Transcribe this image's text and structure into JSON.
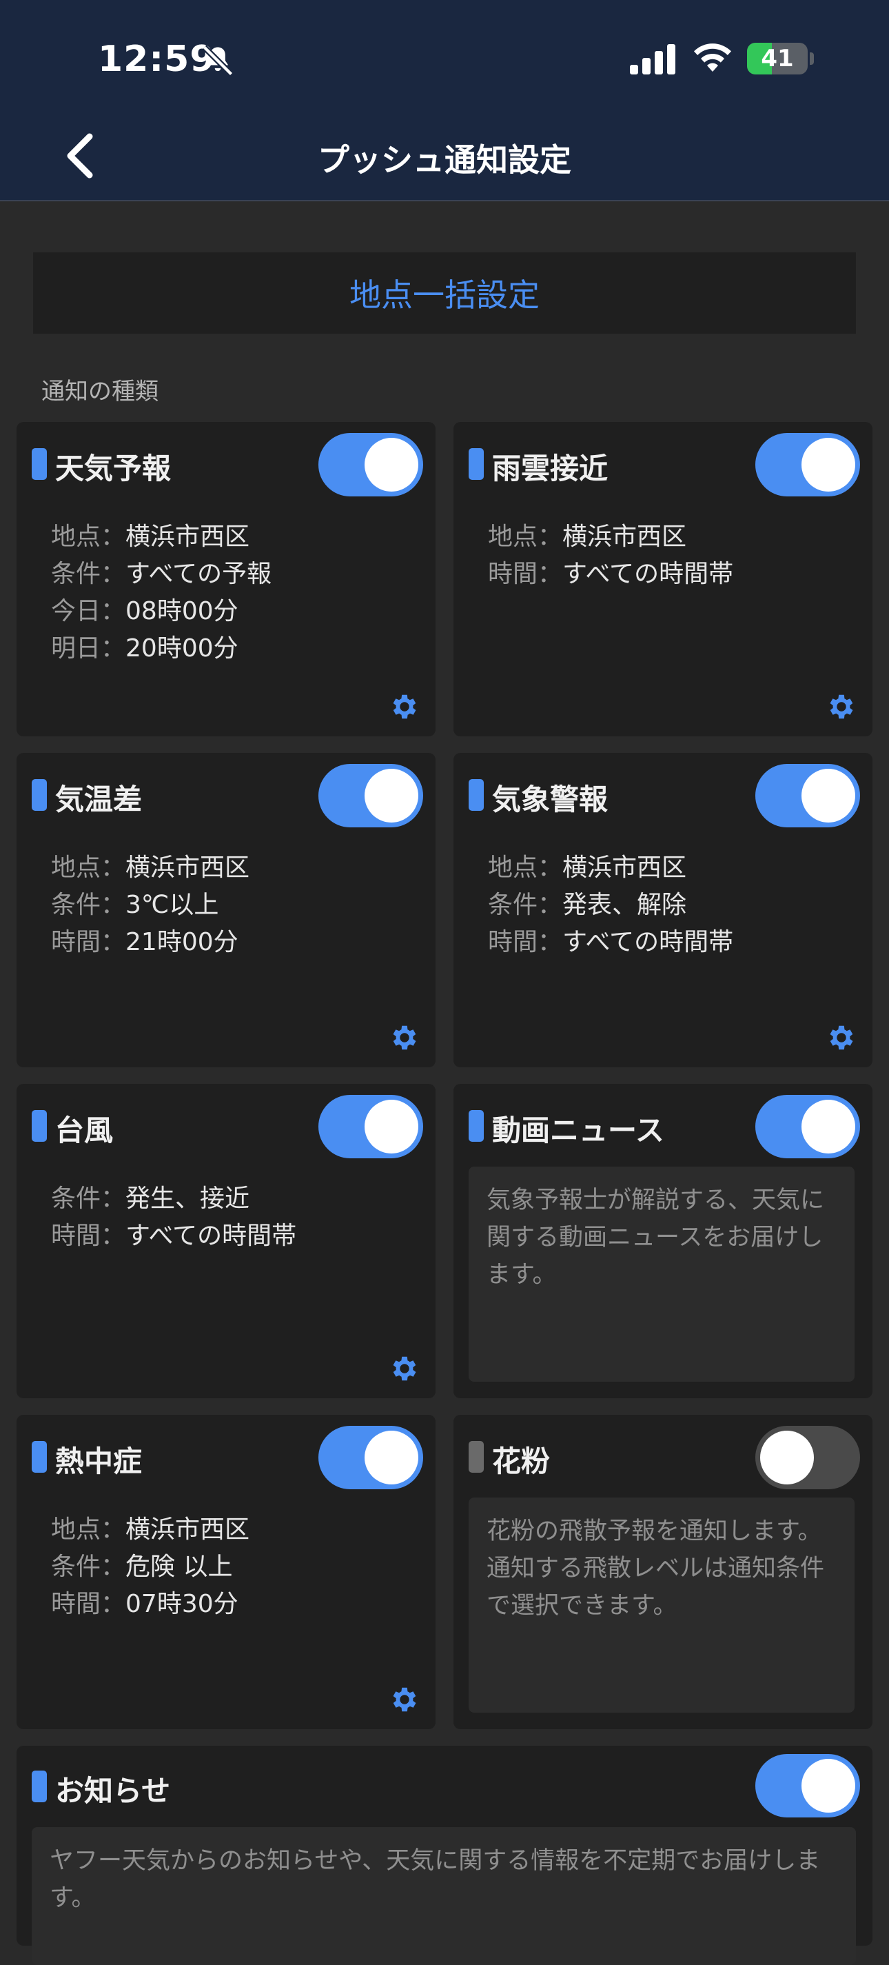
{
  "status_bar": {
    "time": "12:59",
    "battery": "41"
  },
  "header": {
    "title": "プッシュ通知設定"
  },
  "bulk_setting": {
    "label": "地点一括設定"
  },
  "section": {
    "label": "通知の種類"
  },
  "cards": [
    {
      "title": "天気予報",
      "enabled": true,
      "rows": [
        {
          "k": "地点",
          "v": "横浜市西区"
        },
        {
          "k": "条件",
          "v": "すべての予報"
        },
        {
          "k": "今日",
          "v": "08時00分"
        },
        {
          "k": "明日",
          "v": "20時00分"
        }
      ]
    },
    {
      "title": "雨雲接近",
      "enabled": true,
      "rows": [
        {
          "k": "地点",
          "v": "横浜市西区"
        },
        {
          "k": "時間",
          "v": "すべての時間帯"
        }
      ]
    },
    {
      "title": "気温差",
      "enabled": true,
      "rows": [
        {
          "k": "地点",
          "v": "横浜市西区"
        },
        {
          "k": "条件",
          "v": "3℃以上"
        },
        {
          "k": "時間",
          "v": "21時00分"
        }
      ]
    },
    {
      "title": "気象警報",
      "enabled": true,
      "rows": [
        {
          "k": "地点",
          "v": "横浜市西区"
        },
        {
          "k": "条件",
          "v": "発表、解除"
        },
        {
          "k": "時間",
          "v": "すべての時間帯"
        }
      ]
    },
    {
      "title": "台風",
      "enabled": true,
      "rows": [
        {
          "k": "条件",
          "v": "発生、接近"
        },
        {
          "k": "時間",
          "v": "すべての時間帯"
        }
      ]
    },
    {
      "title": "動画ニュース",
      "enabled": true,
      "description": "気象予報士が解説する、天気に関する動画ニュースをお届けします。"
    },
    {
      "title": "熱中症",
      "enabled": true,
      "rows": [
        {
          "k": "地点",
          "v": "横浜市西区"
        },
        {
          "k": "条件",
          "v": "危険 以上"
        },
        {
          "k": "時間",
          "v": "07時30分"
        }
      ]
    },
    {
      "title": "花粉",
      "enabled": false,
      "description": "花粉の飛散予報を通知します。通知する飛散レベルは通知条件で選択できます。"
    }
  ],
  "notice": {
    "title": "お知らせ",
    "enabled": true,
    "description": "ヤフー天気からのお知らせや、天気に関する情報を不定期でお届けします。"
  },
  "colors": {
    "accent": "#4a8ef2",
    "header_bg": "#1a2740",
    "card_bg": "#1f1f1f",
    "page_bg": "#2a2a2a"
  },
  "icons": {
    "back": "chevron-left-icon",
    "bell_muted": "bell-slash-icon",
    "settings": "gear-icon"
  }
}
